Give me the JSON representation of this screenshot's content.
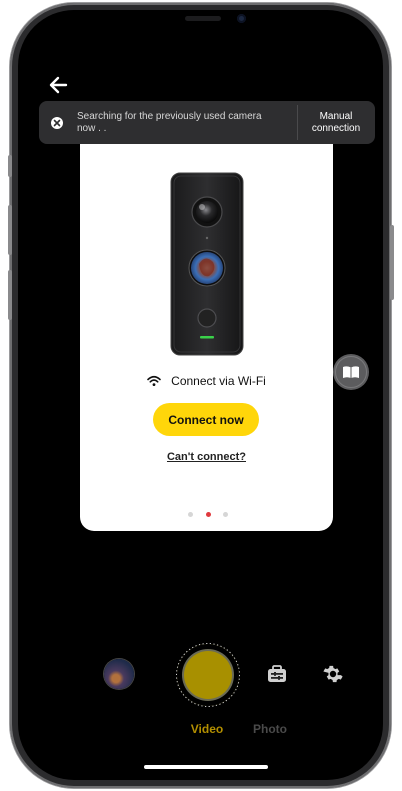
{
  "toast": {
    "message": "Searching for the previously used camera now . .",
    "action_label": "Manual connection"
  },
  "card": {
    "connection_method": "Connect via Wi-Fi",
    "primary_button": "Connect now",
    "secondary_link": "Can't connect?",
    "pagination": {
      "total": 3,
      "active_index": 1
    }
  },
  "capture_bar": {
    "modes": [
      "Video",
      "Photo"
    ],
    "selected_mode": "Video"
  },
  "icons": {
    "back": "arrow-left-icon",
    "toast_close": "close-circle-icon",
    "wifi": "wifi-icon",
    "tutorial": "book-icon",
    "shooting_params": "toolbox-icon",
    "settings": "gear-icon"
  },
  "colors": {
    "accent_yellow": "#ffd60a",
    "active_dot": "#e0393e",
    "selected_mode": "#b38f00",
    "toast_bg": "#2e2e30"
  }
}
